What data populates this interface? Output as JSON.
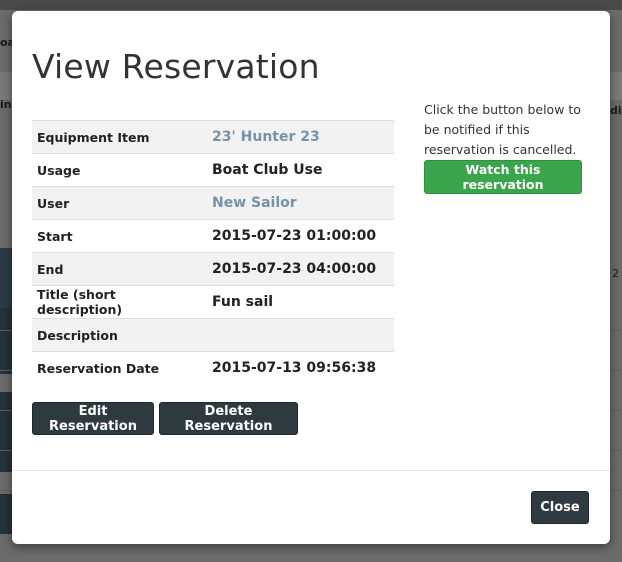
{
  "background": {
    "fragments": [
      "oa",
      "in",
      "di",
      "2"
    ]
  },
  "modal": {
    "title": "View Reservation",
    "details": [
      {
        "label": "Equipment Item",
        "value": "23' Hunter 23",
        "link": true
      },
      {
        "label": "Usage",
        "value": "Boat Club Use",
        "link": false
      },
      {
        "label": "User",
        "value": "New Sailor",
        "link": true
      },
      {
        "label": "Start",
        "value": "2015-07-23 01:00:00",
        "link": false
      },
      {
        "label": "End",
        "value": "2015-07-23 04:00:00",
        "link": false
      },
      {
        "label": "Title (short description)",
        "value": "Fun sail",
        "link": false
      },
      {
        "label": "Description",
        "value": "",
        "link": false
      },
      {
        "label": "Reservation Date",
        "value": "2015-07-13 09:56:38",
        "link": false
      }
    ],
    "edit_label": "Edit Reservation",
    "delete_label": "Delete Reservation",
    "notify_text": "Click the button below to be notified if this reservation is cancelled.",
    "watch_label": "Watch this reservation",
    "close_label": "Close"
  },
  "colors": {
    "link": "#7493a9",
    "success": "#3aa54a",
    "dark_button": "#2f3a40"
  }
}
